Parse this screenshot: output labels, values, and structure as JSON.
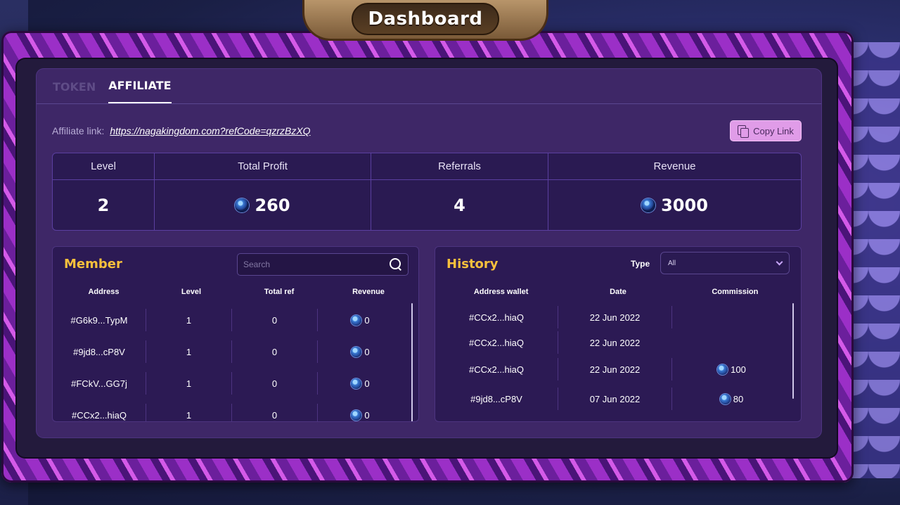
{
  "title": "Dashboard",
  "tabs": [
    {
      "label": "TOKEN",
      "active": false
    },
    {
      "label": "AFFILIATE",
      "active": true
    }
  ],
  "affiliate": {
    "label": "Affiliate link:",
    "link": "https://nagakingdom.com?refCode=qzrzBzXQ",
    "copy_label": "Copy Link"
  },
  "stats": {
    "headers": [
      "Level",
      "Total Profit",
      "Referrals",
      "Revenue"
    ],
    "values": [
      "2",
      "260",
      "4",
      "3000"
    ]
  },
  "member": {
    "title": "Member",
    "search_placeholder": "Search",
    "columns": [
      "Address",
      "Level",
      "Total ref",
      "Revenue"
    ],
    "rows": [
      [
        "#G6k9...TypM",
        "1",
        "0",
        "0"
      ],
      [
        "#9jd8...cP8V",
        "1",
        "0",
        "0"
      ],
      [
        "#FCkV...GG7j",
        "1",
        "0",
        "0"
      ],
      [
        "#CCx2...hiaQ",
        "1",
        "0",
        "0"
      ]
    ]
  },
  "history": {
    "title": "History",
    "type_label": "Type",
    "type_value": "All",
    "columns": [
      "Address wallet",
      "Date",
      "Commission"
    ],
    "rows": [
      [
        "#CCx2...hiaQ",
        "22 Jun 2022",
        ""
      ],
      [
        "#CCx2...hiaQ",
        "22 Jun 2022",
        ""
      ],
      [
        "#CCx2...hiaQ",
        "22 Jun 2022",
        "100"
      ],
      [
        "#9jd8...cP8V",
        "07 Jun 2022",
        "80"
      ]
    ]
  },
  "colors": {
    "accent_gold": "#f7c03c",
    "panel": "#3e2767",
    "copy_button": "#e09ce8"
  }
}
